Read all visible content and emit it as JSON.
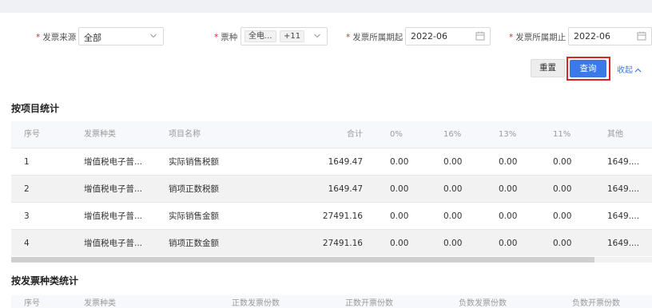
{
  "filters": {
    "source": {
      "label": "发票来源",
      "value": "全部"
    },
    "type": {
      "label": "票种",
      "tag1": "全电...",
      "tag2": "+11"
    },
    "period_start": {
      "label": "发票所属期起",
      "value": "2022-06"
    },
    "period_end": {
      "label": "发票所属期止",
      "value": "2022-06"
    },
    "required_mark": "*"
  },
  "actions": {
    "reset_label": "重置",
    "query_label": "查询",
    "collapse_label": "收起"
  },
  "section1": {
    "title": "按项目统计",
    "columns": [
      "序号",
      "发票种类",
      "项目名称",
      "合计",
      "0%",
      "16%",
      "13%",
      "11%",
      "其他"
    ],
    "rows": [
      [
        "1",
        "增值税电子普...",
        "实际销售税额",
        "1649.47",
        "0.00",
        "0.00",
        "0.00",
        "0.00",
        "1649...."
      ],
      [
        "2",
        "增值税电子普...",
        "销项正数税额",
        "1649.47",
        "0.00",
        "0.00",
        "0.00",
        "0.00",
        "1649...."
      ],
      [
        "3",
        "增值税电子普...",
        "实际销售金额",
        "27491.16",
        "0.00",
        "0.00",
        "0.00",
        "0.00",
        "1649...."
      ],
      [
        "4",
        "增值税电子普...",
        "销项正数金额",
        "27491.16",
        "0.00",
        "0.00",
        "0.00",
        "0.00",
        "1649...."
      ]
    ]
  },
  "section2": {
    "title": "按发票种类统计",
    "columns": [
      "序号",
      "发票种类",
      "正数发票份数",
      "正数开票份数",
      "负数发票份数",
      "负数开票份数"
    ]
  },
  "colors": {
    "accent": "#3a79e8",
    "highlight": "#d9252a",
    "required": "#f5222d"
  },
  "icons": {
    "select": "chevron-down-icon",
    "date": "calendar-icon",
    "collapse": "chevron-up-icon"
  }
}
